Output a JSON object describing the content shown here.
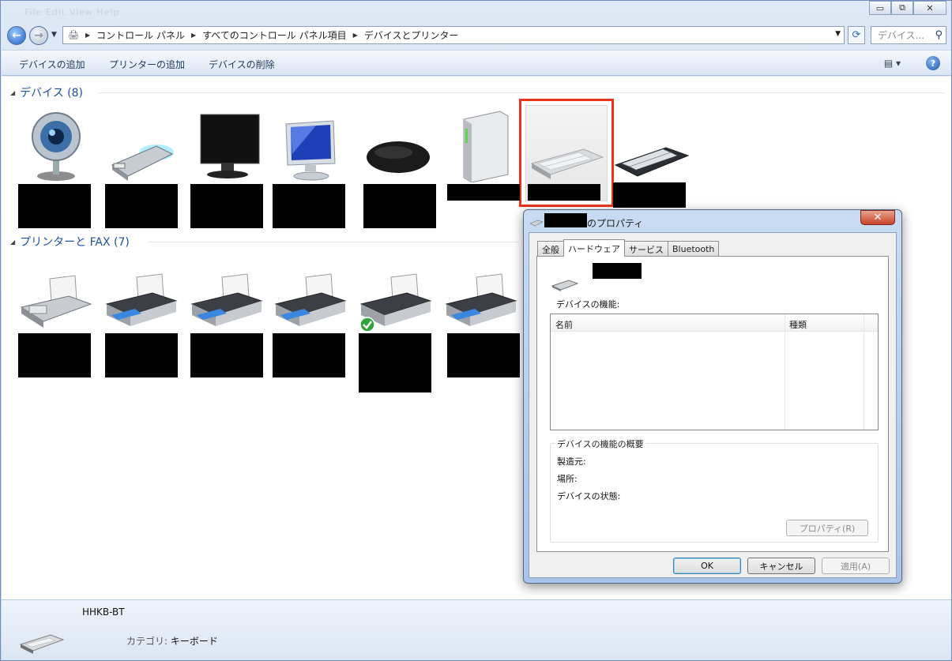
{
  "window": {
    "ghost_menu": "File  Edit  View  Help",
    "controls": {
      "minimize": "▭",
      "restore": "⧉",
      "close": "✕"
    }
  },
  "address": {
    "crumbs": [
      "コントロール パネル",
      "すべてのコントロール パネル項目",
      "デバイスとプリンター"
    ],
    "search_placeholder": "デバイス..."
  },
  "toolbar": {
    "add_device": "デバイスの追加",
    "add_printer": "プリンターの追加",
    "remove_device": "デバイスの削除",
    "help": "?"
  },
  "groups": {
    "devices": "デバイス (8)",
    "printers": "プリンターと FAX (7)"
  },
  "details": {
    "device_name": "HHKB-BT",
    "category_label": "カテゴリ:",
    "category_value": "キーボード"
  },
  "dialog": {
    "title_suffix": "のプロパティ",
    "tabs": [
      "全般",
      "ハードウェア",
      "サービス",
      "Bluetooth"
    ],
    "active_tab": "ハードウェア",
    "functions_label": "デバイスの機能:",
    "col_name": "名前",
    "col_type": "種類",
    "summary_legend": "デバイスの機能の概要",
    "manufacturer": "製造元:",
    "location": "場所:",
    "status": "デバイスの状態:",
    "properties_btn": "プロパティ(R)",
    "ok": "OK",
    "cancel": "キャンセル",
    "apply": "適用(A)"
  },
  "colors": {
    "selection_outline": "#e8341a",
    "group_header": "#1e50a2",
    "default_printer_check": "#2ea43a"
  }
}
